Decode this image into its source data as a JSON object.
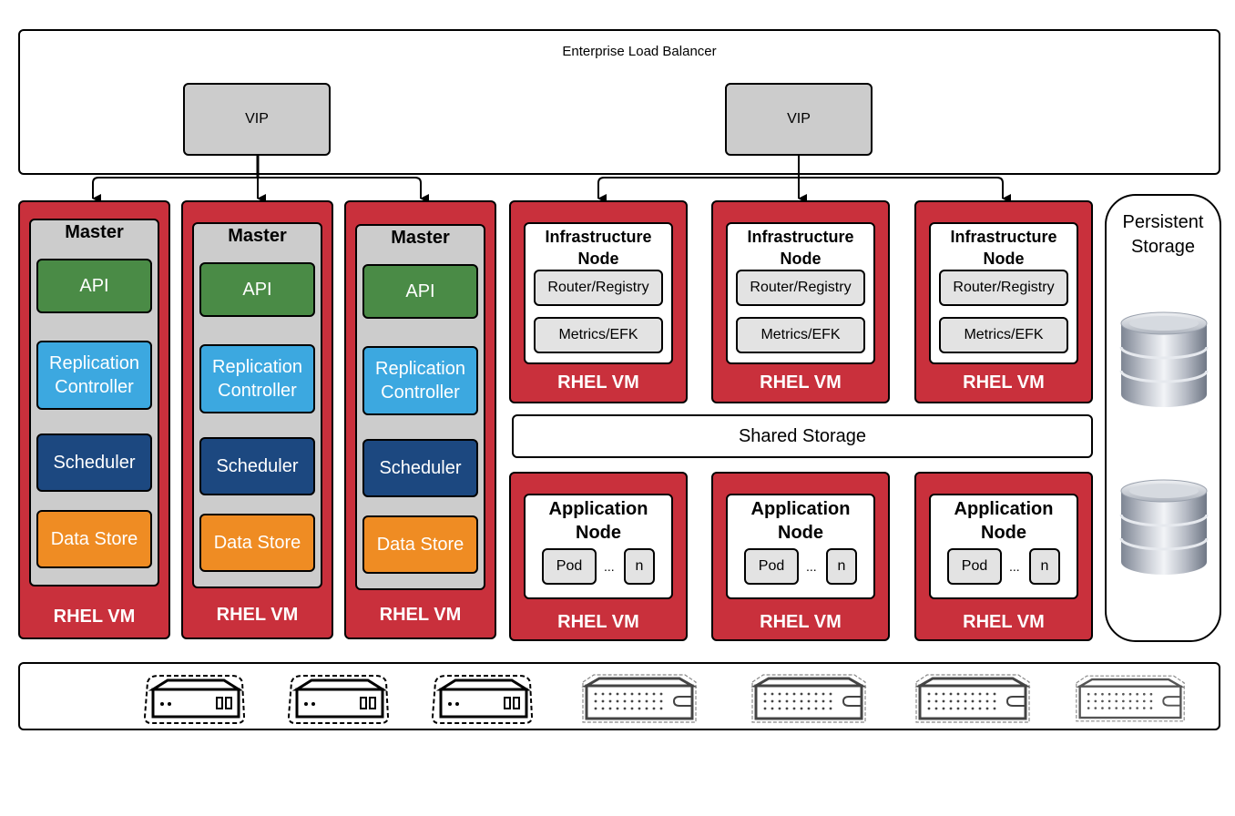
{
  "load_balancer": {
    "title": "Enterprise Load Balancer",
    "vips": [
      {
        "label": "VIP",
        "targets": "masters"
      },
      {
        "label": "VIP",
        "targets": "infrastructure-nodes"
      }
    ]
  },
  "masters": [
    {
      "title": "Master",
      "components": [
        "API",
        "Replication Controller",
        "Scheduler",
        "Data Store"
      ],
      "vm_label": "RHEL VM"
    },
    {
      "title": "Master",
      "components": [
        "API",
        "Replication Controller",
        "Scheduler",
        "Data Store"
      ],
      "vm_label": "RHEL VM"
    },
    {
      "title": "Master",
      "components": [
        "API",
        "Replication Controller",
        "Scheduler",
        "Data Store"
      ],
      "vm_label": "RHEL VM"
    }
  ],
  "master_component_lines": {
    "api": "API",
    "rc_line1": "Replication",
    "rc_line2": "Controller",
    "scheduler": "Scheduler",
    "data_store": "Data Store"
  },
  "infra_nodes": [
    {
      "title_line1": "Infrastructure",
      "title_line2": "Node",
      "services": [
        "Router/Registry",
        "Metrics/EFK"
      ],
      "vm_label": "RHEL VM"
    },
    {
      "title_line1": "Infrastructure",
      "title_line2": "Node",
      "services": [
        "Router/Registry",
        "Metrics/EFK"
      ],
      "vm_label": "RHEL VM"
    },
    {
      "title_line1": "Infrastructure",
      "title_line2": "Node",
      "services": [
        "Router/Registry",
        "Metrics/EFK"
      ],
      "vm_label": "RHEL VM"
    }
  ],
  "shared_storage": {
    "label": "Shared Storage"
  },
  "app_nodes": [
    {
      "title_line1": "Application",
      "title_line2": "Node",
      "pod": "Pod",
      "ellipsis": "...",
      "n": "n",
      "vm_label": "RHEL VM"
    },
    {
      "title_line1": "Application",
      "title_line2": "Node",
      "pod": "Pod",
      "ellipsis": "...",
      "n": "n",
      "vm_label": "RHEL VM"
    },
    {
      "title_line1": "Application",
      "title_line2": "Node",
      "pod": "Pod",
      "ellipsis": "...",
      "n": "n",
      "vm_label": "RHEL VM"
    }
  ],
  "persistent_storage": {
    "title_line1": "Persistent",
    "title_line2": "Storage",
    "icons": [
      "database-icon",
      "database-icon"
    ]
  },
  "hardware": {
    "servers": [
      {
        "icon": "server-appliance-icon"
      },
      {
        "icon": "server-appliance-icon"
      },
      {
        "icon": "server-appliance-icon"
      },
      {
        "icon": "server-rack-icon"
      },
      {
        "icon": "server-rack-icon"
      },
      {
        "icon": "server-rack-icon"
      },
      {
        "icon": "server-rack-icon"
      }
    ]
  },
  "colors": {
    "vm_red": "#c9303c",
    "api_green": "#4a8b46",
    "rc_blue": "#3ca8e0",
    "scheduler_navy": "#1c4880",
    "data_store_orange": "#ef8c23",
    "vip_gray": "#cccccc",
    "service_gray": "#e3e3e3"
  }
}
